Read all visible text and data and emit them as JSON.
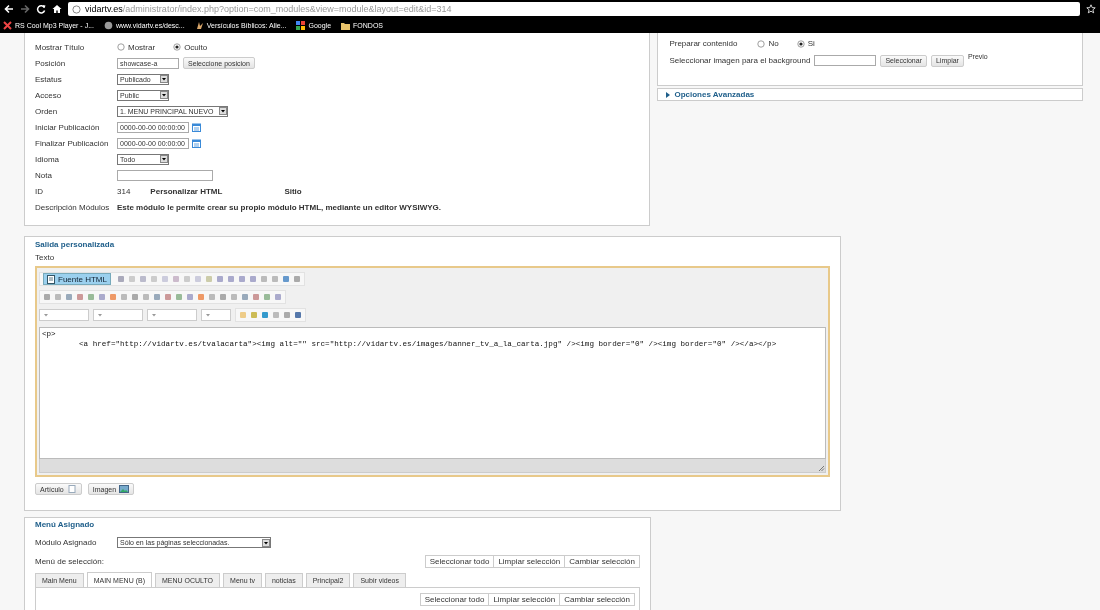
{
  "browser": {
    "url_host": "vidartv.es",
    "url_path": "/administrator/index.php?option=com_modules&view=module&layout=edit&id=314",
    "bookmarks": [
      "RS Cool Mp3 Player - J...",
      "www.vidartv.es/desc...",
      "Versículos Bíblicos: Alie...",
      "Google",
      "FONDOS"
    ]
  },
  "details": {
    "rows": [
      {
        "kind": "radio",
        "label": "Mostrar Título",
        "options": [
          {
            "label": "Mostrar",
            "selected": false
          },
          {
            "label": "Oculto",
            "selected": true
          }
        ]
      },
      {
        "kind": "position",
        "label": "Posición",
        "value": "showcase-a",
        "button": "Seleccione posicion"
      },
      {
        "kind": "select",
        "label": "Estatus",
        "value": "Publicado"
      },
      {
        "kind": "select",
        "label": "Acceso",
        "value": "Public"
      },
      {
        "kind": "select",
        "label": "Orden",
        "value": "1. MENU PRINCIPAL NUEVO"
      },
      {
        "kind": "date",
        "label": "Iniciar Publicación",
        "value": "0000-00-00 00:00:00"
      },
      {
        "kind": "date",
        "label": "Finalizar Publicación",
        "value": "0000-00-00 00:00:00"
      },
      {
        "kind": "select",
        "label": "Idioma",
        "value": "Todo"
      },
      {
        "kind": "text",
        "label": "Nota"
      },
      {
        "kind": "info",
        "label": "ID",
        "values": [
          "314",
          "Personalizar HTML",
          "Sitio"
        ]
      },
      {
        "kind": "info",
        "label": "Descripción Módulos",
        "values": [
          "Este módulo le permite crear su propio módulo HTML, mediante un editor WYSIWYG."
        ]
      }
    ]
  },
  "options": {
    "rows": [
      {
        "kind": "radio",
        "label": "Preparar contenido",
        "options": [
          {
            "label": "No",
            "selected": false
          },
          {
            "label": "Si",
            "selected": true
          }
        ]
      },
      {
        "kind": "image",
        "label": "Seleccionar imagen para el background",
        "buttons": [
          "Seleccionar",
          "Limpiar"
        ],
        "note": "Previo"
      }
    ],
    "advanced": {
      "label": "Opciones Avanzadas",
      "expanded": false
    }
  },
  "editor": {
    "legend": "Salida personalizada",
    "label": "Texto",
    "source_button": {
      "label": "Fuente HTML",
      "selected": true
    },
    "code": [
      "<p>",
      "<a href=\"http://vidartv.es/tvalacarta\"><img alt=\"\" src=\"http://vidartv.es/images/banner_tv_a_la_carta.jpg\" /><img border=\"0\" /><img border=\"0\" /></a></p>"
    ],
    "buttons": [
      "Artículo",
      "Imagen"
    ]
  },
  "menu": {
    "legend": "Menú Asignado",
    "assigned_label": "Módulo Asignado",
    "assigned_value": "Sólo en las páginas seleccionadas.",
    "selection_label": "Menú de selección:",
    "actions": [
      "Seleccionar todo",
      "Limpiar selección",
      "Cambiar selección"
    ],
    "tabs": [
      {
        "label": "Main Menu",
        "selected": false
      },
      {
        "label": "MAIN MENU (B)",
        "selected": true
      },
      {
        "label": "MENU OCULTO",
        "selected": false
      },
      {
        "label": "Menu tv",
        "selected": false
      },
      {
        "label": "noticias",
        "selected": false
      },
      {
        "label": "Principal2",
        "selected": false
      },
      {
        "label": "Subir videos",
        "selected": false
      }
    ],
    "tab_actions": [
      "Seleccionar todo",
      "Limpiar selección",
      "Cambiar selección"
    ]
  }
}
